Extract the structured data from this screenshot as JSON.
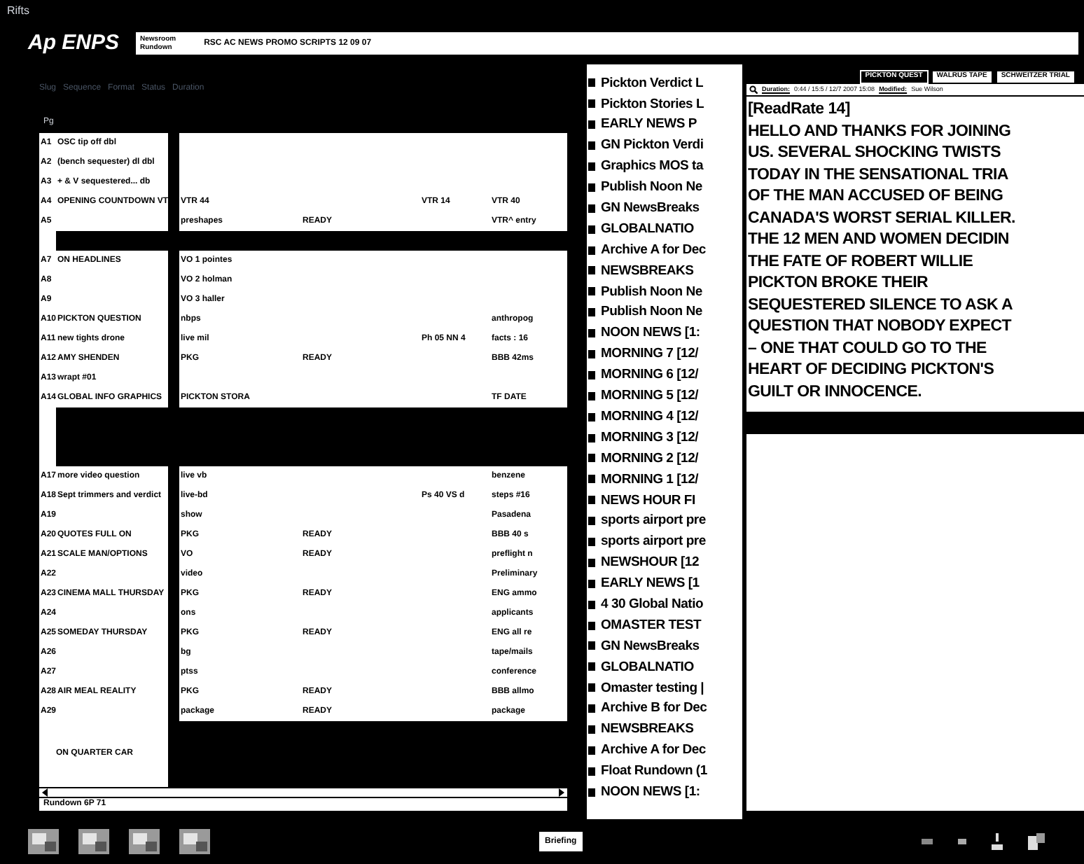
{
  "window": {
    "title": "Rifts"
  },
  "logo": "Ap ENPS",
  "header": {
    "label_1": "Newsroom",
    "label_2": "Rundown",
    "title": "RSC AC NEWS PROMO SCRIPTS 12 09 07"
  },
  "toolbar_text": "Slug   Sequence   Format   Status   Duration",
  "rundown": {
    "header": "Pg",
    "rows": [
      {
        "kind": "story",
        "page": "A1",
        "slug": "OSC tip off dbl"
      },
      {
        "kind": "story",
        "page": "A2",
        "slug": "(bench sequester) dl dbl"
      },
      {
        "kind": "story",
        "page": "A3",
        "slug": "+ & V sequestered... db"
      },
      {
        "kind": "story",
        "page": "A4",
        "slug": "OPENING COUNTDOWN VT",
        "format": "VTR 44",
        "time": "VTR 14",
        "column_6": "VTR 40"
      },
      {
        "kind": "story",
        "page": "A5",
        "format": "preshapes",
        "status": "READY",
        "column_6": "VTR^ entry"
      },
      {
        "kind": "break"
      },
      {
        "kind": "story",
        "page": "A7",
        "slug": "ON HEADLINES",
        "format": "VO 1 pointes"
      },
      {
        "kind": "story",
        "page": "A8",
        "format": "VO 2 holman"
      },
      {
        "kind": "story",
        "page": "A9",
        "format": "VO 3 haller"
      },
      {
        "kind": "story",
        "page": "A10",
        "slug": "PICKTON QUESTION",
        "format": "nbps",
        "column_6": "anthropog"
      },
      {
        "kind": "story",
        "page": "A11",
        "slug": "new tights drone",
        "format": "live mil",
        "time": "Ph 05 NN 4",
        "column_6": "facts : 16"
      },
      {
        "kind": "story",
        "page": "A12",
        "slug": "AMY SHENDEN",
        "format": "PKG",
        "status": "READY",
        "column_6": "BBB 42ms"
      },
      {
        "kind": "story",
        "page": "A13",
        "slug": "wrapt #01"
      },
      {
        "kind": "story",
        "page": "A14",
        "slug": "GLOBAL INFO GRAPHICS",
        "format": "PICKTON STORA",
        "column_6": "TF DATE"
      },
      {
        "kind": "break"
      },
      {
        "kind": "break"
      },
      {
        "kind": "break"
      },
      {
        "kind": "story",
        "page": "A17",
        "slug": "more video question",
        "format": "live vb",
        "column_6": "benzene"
      },
      {
        "kind": "story",
        "page": "A18",
        "slug": "Sept trimmers and verdict",
        "format": "live-bd",
        "time": "Ps 40 VS d",
        "column_6": "steps #16"
      },
      {
        "kind": "story",
        "page": "A19",
        "format": "show",
        "column_6": "Pasadena"
      },
      {
        "kind": "story",
        "page": "A20",
        "slug": "QUOTES FULL ON",
        "format": "PKG",
        "status": "READY",
        "column_6": "BBB 40 s"
      },
      {
        "kind": "story",
        "page": "A21",
        "slug": "SCALE MAN/OPTIONS",
        "format": "VO",
        "status": "READY",
        "column_6": "preflight n"
      },
      {
        "kind": "story",
        "page": "A22",
        "format": "video",
        "column_6": "Preliminary"
      },
      {
        "kind": "story",
        "page": "A23",
        "slug": "CINEMA MALL THURSDAY",
        "format": "PKG",
        "status": "READY",
        "column_6": "ENG ammo"
      },
      {
        "kind": "story",
        "page": "A24",
        "format": "ons",
        "column_6": "applicants"
      },
      {
        "kind": "story",
        "page": "A25",
        "slug": "SOMEDAY THURSDAY",
        "format": "PKG",
        "status": "READY",
        "column_6": "ENG all re"
      },
      {
        "kind": "story",
        "page": "A26",
        "format": "bg",
        "column_6": "tape/mails"
      },
      {
        "kind": "story",
        "page": "A27",
        "format": "ptss",
        "column_6": "conference"
      },
      {
        "kind": "story",
        "page": "A28",
        "slug": "AIR MEAL REALITY",
        "format": "PKG",
        "status": "READY",
        "column_6": "BBB allmo"
      },
      {
        "kind": "story",
        "page": "A29",
        "format": "package",
        "status": "READY",
        "column_6": "package"
      },
      {
        "kind": "closing",
        "slug": "ON QUARTER CAR"
      }
    ],
    "footer": "Rundown 6P 71"
  },
  "rundown_list": [
    "Pickton Verdict L",
    "Pickton Stories L",
    "EARLY NEWS P",
    "GN Pickton Verdi",
    "Graphics MOS ta",
    "Publish Noon Ne",
    "GN NewsBreaks",
    "GLOBALNATIO",
    "Archive A for Dec",
    "NEWSBREAKS",
    "Publish Noon Ne",
    "Publish Noon Ne",
    "NOON NEWS [1:",
    "MORNING 7 [12/",
    "MORNING 6 [12/",
    "MORNING 5 [12/",
    "MORNING 4 [12/",
    "MORNING 3 [12/",
    "MORNING 2 [12/",
    "MORNING 1 [12/",
    "NEWS HOUR FI",
    "sports airport pre",
    "sports airport pre",
    "NEWSHOUR [12",
    "EARLY NEWS [1",
    "4 30 Global Natio",
    "OMASTER TEST",
    "GN NewsBreaks",
    "GLOBALNATIO",
    "Omaster testing |",
    "Archive B for Dec",
    "NEWSBREAKS",
    "Archive A for Dec",
    "Float Rundown (1",
    "NOON NEWS [1:"
  ],
  "script": {
    "tabs": [
      {
        "label": "PICKTON QUEST",
        "selected": true
      },
      {
        "label": "WALRUS TAPE",
        "selected": false
      },
      {
        "label": "SCHWEITZER TRIAL",
        "selected": false
      }
    ],
    "duration_label": "Duration:",
    "info": "0:44 / 15:5 / 12/7 2007 15:08",
    "modified_label": "Modified:",
    "modified_by": "Sue Wilson",
    "lines": [
      "[ReadRate 14]",
      "HELLO AND THANKS FOR JOINING",
      "US. SEVERAL SHOCKING TWISTS",
      "TODAY IN THE SENSATIONAL TRIA",
      "OF THE MAN ACCUSED OF BEING",
      "CANADA'S WORST SERIAL KILLER.",
      "THE 12 MEN AND WOMEN DECIDIN",
      "THE FATE OF ROBERT WILLIE",
      "PICKTON BROKE THEIR",
      "SEQUESTERED SILENCE TO ASK A",
      "QUESTION THAT NOBODY EXPECT",
      "– ONE THAT COULD GO TO THE",
      "HEART OF DECIDING PICKTON'S",
      "GUILT OR INNOCENCE."
    ]
  },
  "taskbar": {
    "button": "Briefing"
  }
}
